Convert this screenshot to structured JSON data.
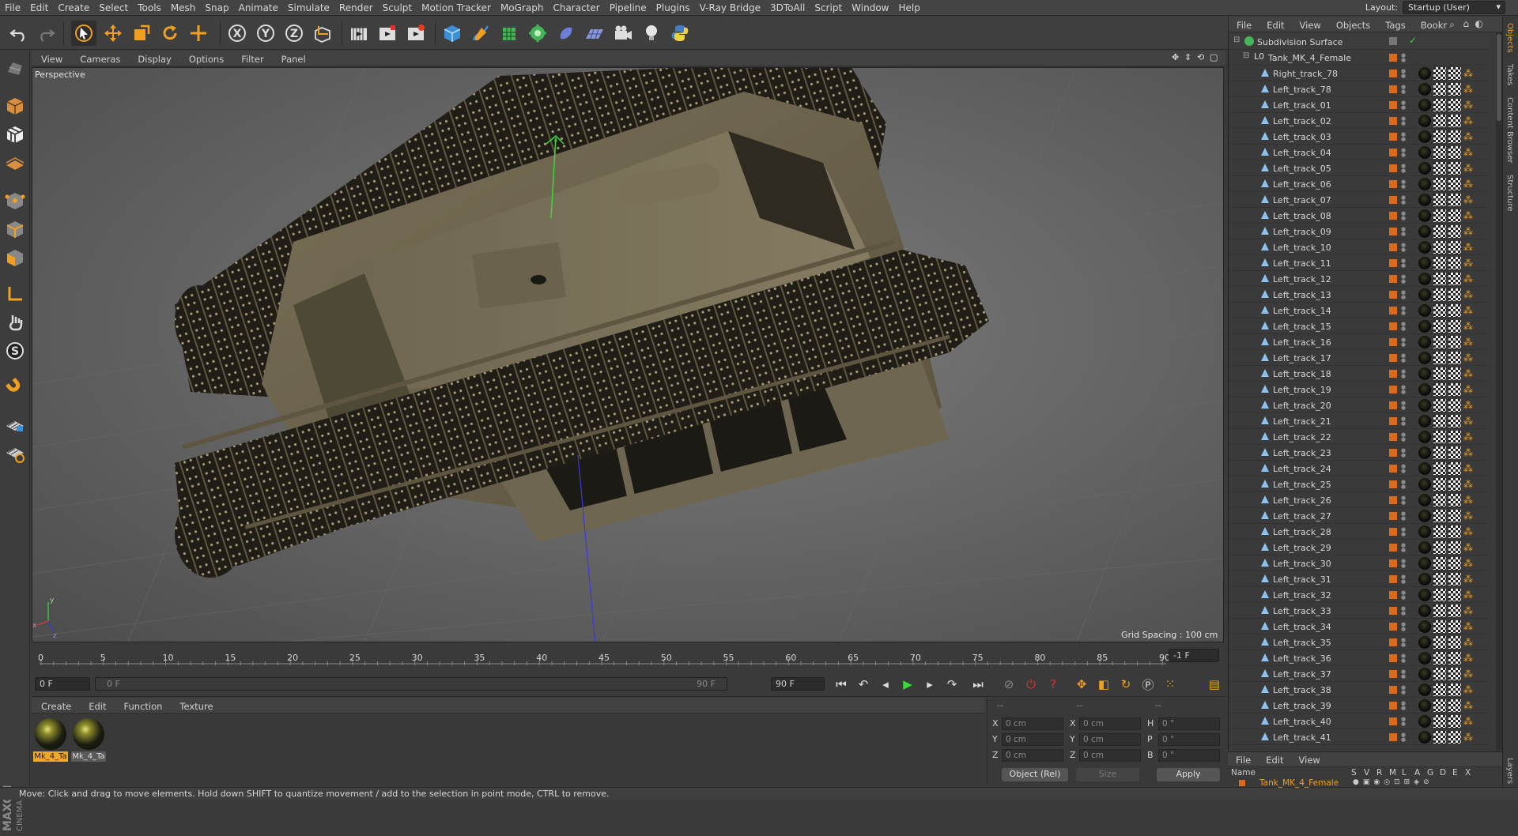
{
  "menubar": {
    "items": [
      "File",
      "Edit",
      "Create",
      "Select",
      "Tools",
      "Mesh",
      "Snap",
      "Animate",
      "Simulate",
      "Render",
      "Sculpt",
      "Motion Tracker",
      "MoGraph",
      "Character",
      "Pipeline",
      "Plugins",
      "V-Ray Bridge",
      "3DToAll",
      "Script",
      "Window",
      "Help"
    ],
    "layout_label": "Layout:",
    "layout_value": "Startup (User)"
  },
  "viewport": {
    "menu": [
      "View",
      "Cameras",
      "Display",
      "Options",
      "Filter",
      "Panel"
    ],
    "label": "Perspective",
    "grid_spacing": "Grid Spacing : 100 cm",
    "axis_labels": {
      "y": "y",
      "x": "x",
      "z": "z"
    }
  },
  "timeline": {
    "ticks": [
      "0",
      "5",
      "10",
      "15",
      "20",
      "25",
      "30",
      "35",
      "40",
      "45",
      "50",
      "55",
      "60",
      "65",
      "70",
      "75",
      "80",
      "85",
      "90"
    ],
    "current_frame": "-1 F",
    "start_field": "0 F",
    "range_start": "0 F",
    "range_end": "90 F",
    "end_field": "90 F"
  },
  "materials": {
    "menu": [
      "Create",
      "Edit",
      "Function",
      "Texture"
    ],
    "items": [
      {
        "name": "Mk_4_Ta",
        "selected": true
      },
      {
        "name": "Mk_4_Ta",
        "selected": false
      }
    ]
  },
  "coordinates": {
    "header": [
      "--",
      "--",
      "--"
    ],
    "rows": [
      {
        "a": "X",
        "av": "0 cm",
        "b": "X",
        "bv": "0 cm",
        "c": "H",
        "cv": "0 °"
      },
      {
        "a": "Y",
        "av": "0 cm",
        "b": "Y",
        "bv": "0 cm",
        "c": "P",
        "cv": "0 °"
      },
      {
        "a": "Z",
        "av": "0 cm",
        "b": "Z",
        "bv": "0 cm",
        "c": "B",
        "cv": "0 °"
      }
    ],
    "mode": "Object (Rel)",
    "size": "Size",
    "apply": "Apply"
  },
  "status": "Move: Click and drag to move elements. Hold down SHIFT to quantize movement / add to the selection in point mode, CTRL to remove.",
  "objects": {
    "menu": [
      "File",
      "Edit",
      "View",
      "Objects",
      "Tags",
      "Bookr"
    ],
    "root": "Subdivision Surface",
    "group": "Tank_MK_4_Female",
    "children": [
      "Right_track_78",
      "Left_track_78",
      "Left_track_01",
      "Left_track_02",
      "Left_track_03",
      "Left_track_04",
      "Left_track_05",
      "Left_track_06",
      "Left_track_07",
      "Left_track_08",
      "Left_track_09",
      "Left_track_10",
      "Left_track_11",
      "Left_track_12",
      "Left_track_13",
      "Left_track_14",
      "Left_track_15",
      "Left_track_16",
      "Left_track_17",
      "Left_track_18",
      "Left_track_19",
      "Left_track_20",
      "Left_track_21",
      "Left_track_22",
      "Left_track_23",
      "Left_track_24",
      "Left_track_25",
      "Left_track_26",
      "Left_track_27",
      "Left_track_28",
      "Left_track_29",
      "Left_track_30",
      "Left_track_31",
      "Left_track_32",
      "Left_track_33",
      "Left_track_34",
      "Left_track_35",
      "Left_track_36",
      "Left_track_37",
      "Left_track_38",
      "Left_track_39",
      "Left_track_40",
      "Left_track_41"
    ]
  },
  "layers": {
    "menu": [
      "File",
      "Edit",
      "View"
    ],
    "header": {
      "name": "Name",
      "cols": [
        "S",
        "V",
        "R",
        "M",
        "L",
        "A",
        "G",
        "D",
        "E",
        "X"
      ]
    },
    "row": "Tank_MK_4_Female"
  },
  "sidetabs": [
    "Objects",
    "Takes",
    "Content Browser",
    "Structure",
    "Layers"
  ],
  "colors": {
    "accent": "#f0a82a",
    "object_orange": "#d86b1e",
    "tank": "#6b6248"
  }
}
